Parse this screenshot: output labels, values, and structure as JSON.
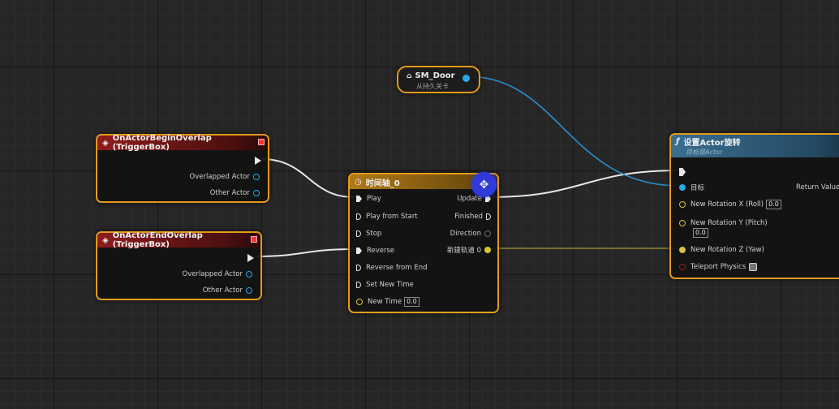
{
  "nodes": {
    "sm_door": {
      "title": "SM_Door",
      "subtitle": "从持久关卡"
    },
    "begin_overlap": {
      "title": "OnActorBeginOverlap (TriggerBox)",
      "pins": [
        "Overlapped Actor",
        "Other Actor"
      ]
    },
    "end_overlap": {
      "title": "OnActorEndOverlap (TriggerBox)",
      "pins": [
        "Overlapped Actor",
        "Other Actor"
      ]
    },
    "timeline": {
      "title": "时间轴_0",
      "inputs": [
        "Play",
        "Play from Start",
        "Stop",
        "Reverse",
        "Reverse from End",
        "Set New Time",
        "New Time"
      ],
      "new_time_value": "0.0",
      "outputs": [
        "Update",
        "Finished",
        "Direction",
        "新建轨道 0"
      ]
    },
    "set_rotation": {
      "title": "设置Actor旋转",
      "subtitle": "目标是Actor",
      "target_label": "目标",
      "return_label": "Return Value",
      "rot_x_label": "New Rotation X (Roll)",
      "rot_x_value": "0.0",
      "rot_y_label": "New Rotation Y (Pitch)",
      "rot_y_value": "0.0",
      "rot_z_label": "New Rotation Z (Yaw)",
      "teleport_label": "Teleport Physics"
    }
  },
  "icons": {
    "event": "diamond-icon",
    "timeline": "clock-icon",
    "function": "function-icon",
    "move": "move-cross-icon"
  },
  "colors": {
    "selection_border": "#e49a1c",
    "object_pin": "#2aa7e8",
    "float_pin": "#d8c23a",
    "exec_wire": "#e8e8e8"
  }
}
